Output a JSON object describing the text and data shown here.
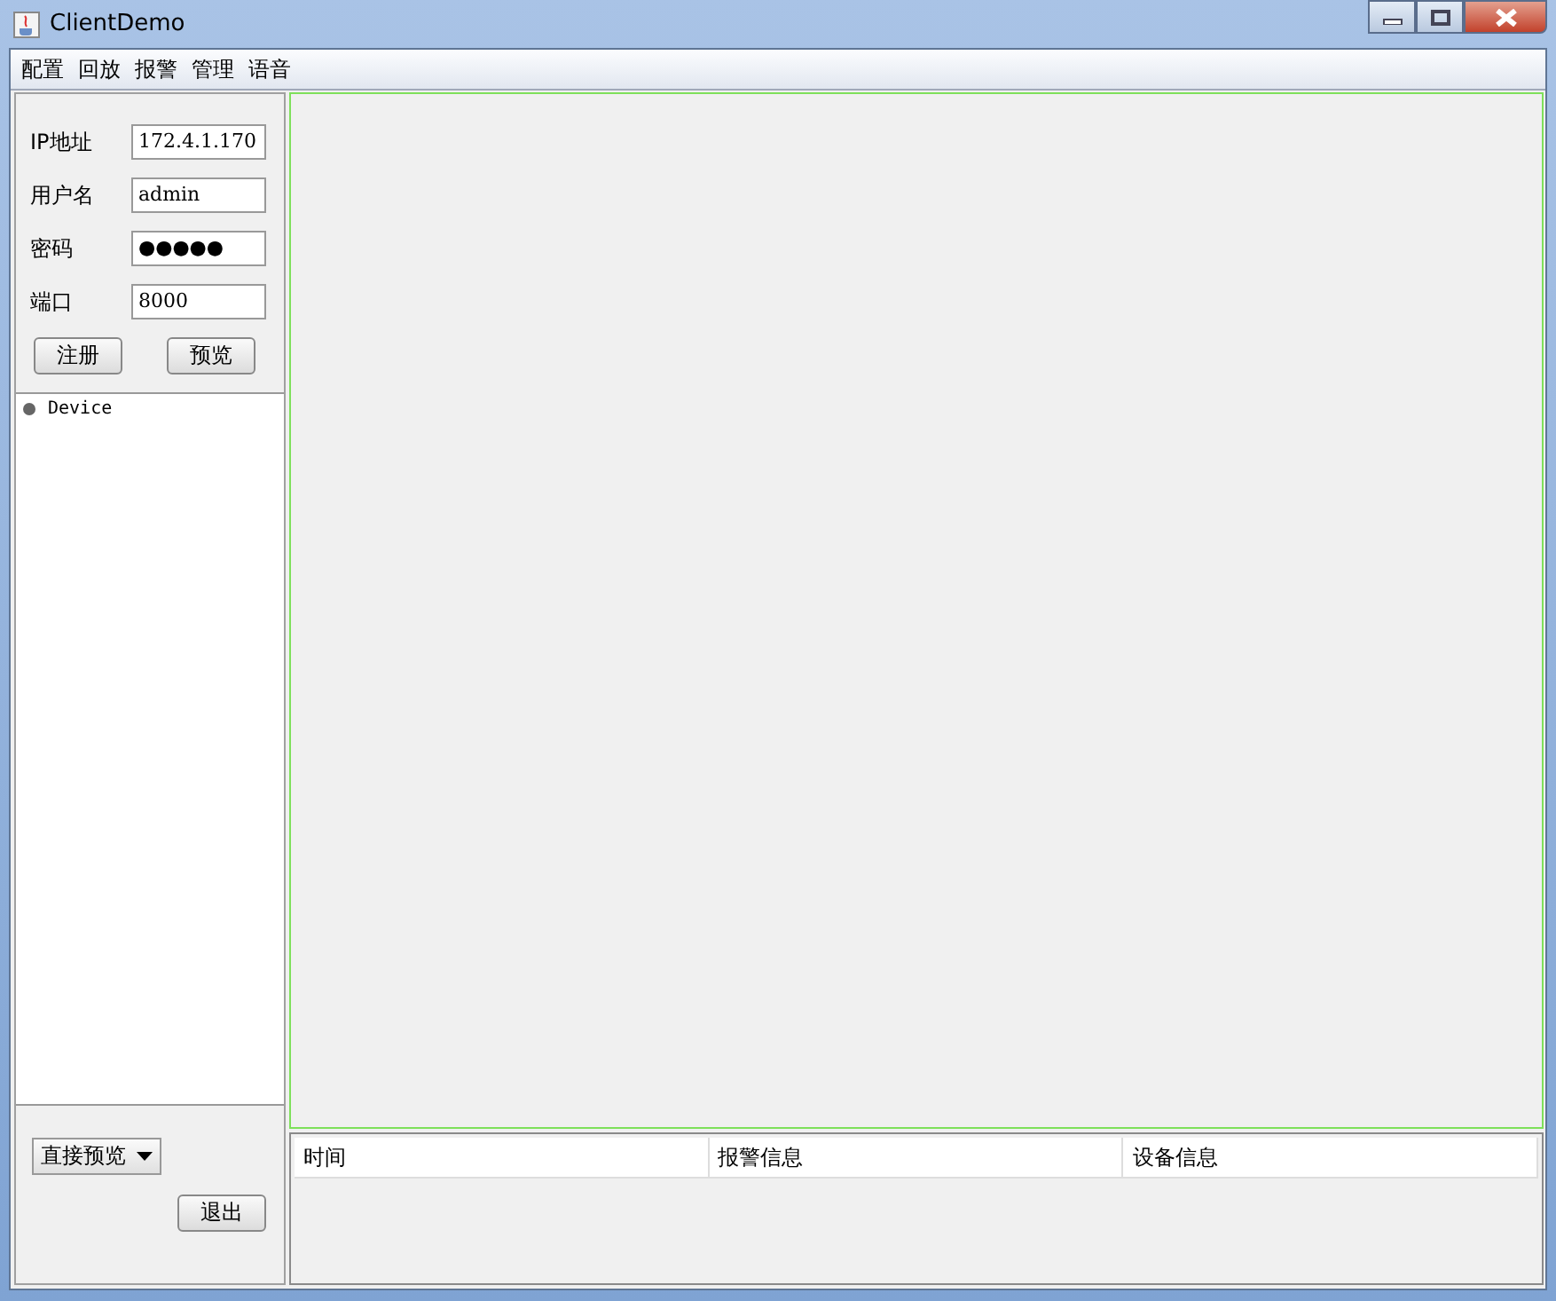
{
  "window": {
    "title": "ClientDemo"
  },
  "menu": [
    "配置",
    "回放",
    "报警",
    "管理",
    "语音"
  ],
  "login": {
    "fields": [
      {
        "label": "IP地址",
        "value": "172.4.1.170"
      },
      {
        "label": "用户名",
        "value": "admin"
      },
      {
        "label": "密码",
        "value": "●●●●●"
      },
      {
        "label": "端口",
        "value": "8000"
      }
    ],
    "buttons": [
      "注册",
      "预览"
    ]
  },
  "device_tree": [
    {
      "label": "Device"
    }
  ],
  "preview_mode": {
    "value": "直接预览"
  },
  "exit_button": "退出",
  "alarm_table": {
    "columns": [
      "时间",
      "报警信息",
      "设备信息"
    ]
  }
}
